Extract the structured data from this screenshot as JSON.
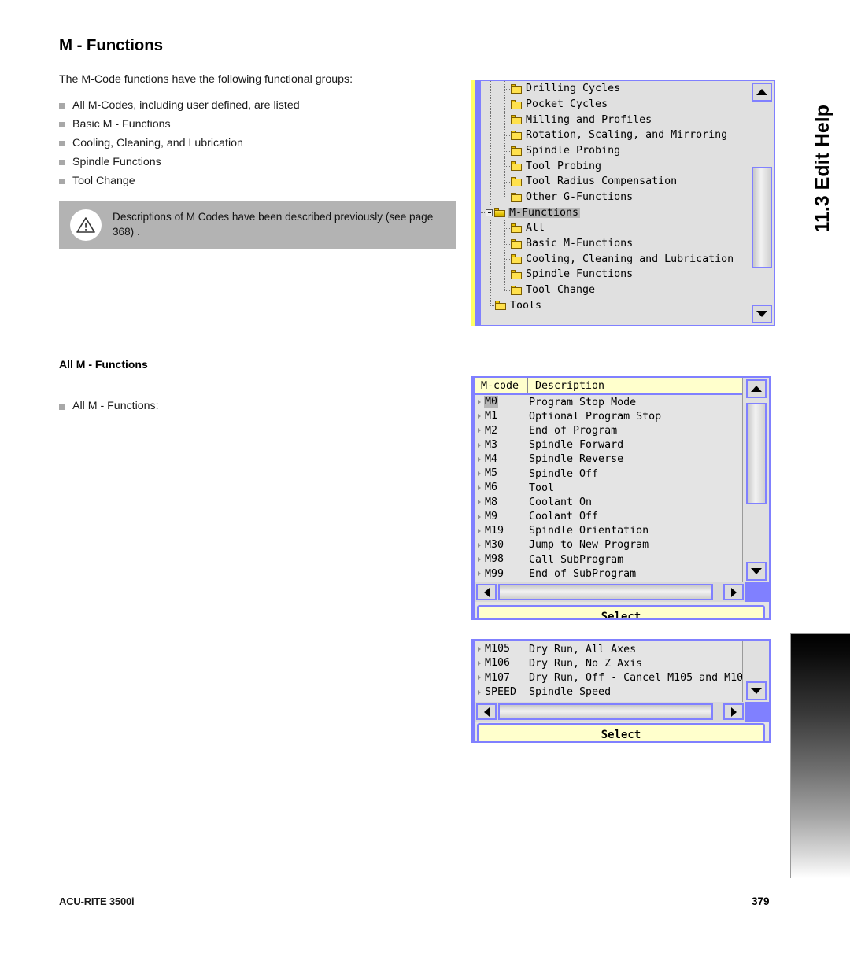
{
  "document": {
    "title": "M - Functions",
    "intro": "The M-Code functions have the following functional groups:",
    "groups": [
      "All M-Codes, including user defined, are listed",
      "Basic M - Functions",
      "Cooling, Cleaning, and Lubrication",
      "Spindle Functions",
      "Tool Change"
    ],
    "note": {
      "icon": "warning-triangle-icon",
      "text": "Descriptions of M Codes have been described previously (see page 368) ."
    },
    "section_heading": "All M - Functions",
    "section_bullet": "All M - Functions:",
    "chapter_tab": "11.3 Edit Help",
    "footer_left": "ACU-RITE 3500i",
    "footer_right": "379"
  },
  "tree_widget": {
    "name": "help-topic-tree",
    "items": [
      {
        "label": "Drilling Cycles",
        "indent": 1,
        "icon": "folder-icon",
        "selected": false,
        "expander": "none",
        "last": false
      },
      {
        "label": "Pocket Cycles",
        "indent": 1,
        "icon": "folder-icon",
        "selected": false,
        "expander": "none",
        "last": false
      },
      {
        "label": "Milling and Profiles",
        "indent": 1,
        "icon": "folder-icon",
        "selected": false,
        "expander": "none",
        "last": false
      },
      {
        "label": "Rotation, Scaling, and Mirroring",
        "indent": 1,
        "icon": "folder-icon",
        "selected": false,
        "expander": "none",
        "last": false
      },
      {
        "label": "Spindle Probing",
        "indent": 1,
        "icon": "folder-icon",
        "selected": false,
        "expander": "none",
        "last": false
      },
      {
        "label": "Tool Probing",
        "indent": 1,
        "icon": "folder-icon",
        "selected": false,
        "expander": "none",
        "last": false
      },
      {
        "label": "Tool Radius Compensation",
        "indent": 1,
        "icon": "folder-icon",
        "selected": false,
        "expander": "none",
        "last": false
      },
      {
        "label": "Other G-Functions",
        "indent": 1,
        "icon": "folder-icon",
        "selected": false,
        "expander": "none",
        "last": true
      },
      {
        "label": "M-Functions",
        "indent": 0,
        "icon": "folder-open-icon",
        "selected": true,
        "expander": "minus",
        "last": false
      },
      {
        "label": "All",
        "indent": 1,
        "icon": "folder-icon",
        "selected": false,
        "expander": "none",
        "last": false
      },
      {
        "label": "Basic M-Functions",
        "indent": 1,
        "icon": "folder-icon",
        "selected": false,
        "expander": "none",
        "last": false
      },
      {
        "label": "Cooling, Cleaning and Lubrication",
        "indent": 1,
        "icon": "folder-icon",
        "selected": false,
        "expander": "none",
        "last": false
      },
      {
        "label": "Spindle Functions",
        "indent": 1,
        "icon": "folder-icon",
        "selected": false,
        "expander": "none",
        "last": false
      },
      {
        "label": "Tool Change",
        "indent": 1,
        "icon": "folder-icon",
        "selected": false,
        "expander": "none",
        "last": true
      },
      {
        "label": "Tools",
        "indent": 0,
        "icon": "folder-icon",
        "selected": false,
        "expander": "none",
        "last": true
      }
    ],
    "scrollbar": {
      "up_icon": "scroll-up-arrow-icon",
      "down_icon": "scroll-down-arrow-icon",
      "thumb_top_pct": 32,
      "thumb_height_pct": 50
    }
  },
  "table_all": {
    "name": "m-code-table-all",
    "columns": [
      "M-code",
      "Description"
    ],
    "rows": [
      {
        "code": "M0",
        "desc": "Program Stop Mode",
        "selected": true
      },
      {
        "code": "M1",
        "desc": "Optional Program Stop",
        "selected": false
      },
      {
        "code": "M2",
        "desc": "End of Program",
        "selected": false
      },
      {
        "code": "M3",
        "desc": "Spindle Forward",
        "selected": false
      },
      {
        "code": "M4",
        "desc": "Spindle Reverse",
        "selected": false
      },
      {
        "code": "M5",
        "desc": "Spindle Off",
        "selected": false
      },
      {
        "code": "M6",
        "desc": "Tool",
        "selected": false
      },
      {
        "code": "M8",
        "desc": "Coolant On",
        "selected": false
      },
      {
        "code": "M9",
        "desc": "Coolant Off",
        "selected": false
      },
      {
        "code": "M19",
        "desc": "Spindle Orientation",
        "selected": false
      },
      {
        "code": "M30",
        "desc": "Jump to New Program",
        "selected": false
      },
      {
        "code": "M98",
        "desc": "Call SubProgram",
        "selected": false
      },
      {
        "code": "M99",
        "desc": "End of SubProgram",
        "selected": false
      }
    ],
    "select_label": "Select",
    "vscroll": {
      "thumb_top_pct": 3,
      "thumb_height_pct": 62
    },
    "hscroll": {
      "thumb_left_pct": 0,
      "thumb_width_pct": 96
    }
  },
  "table_more": {
    "name": "m-code-table-continued",
    "rows": [
      {
        "code": "M105",
        "desc": "Dry Run, All Axes",
        "selected": false
      },
      {
        "code": "M106",
        "desc": "Dry Run, No Z Axis",
        "selected": false
      },
      {
        "code": "M107",
        "desc": "Dry Run, Off - Cancel M105 and M10",
        "selected": false
      },
      {
        "code": "SPEED",
        "desc": "Spindle Speed",
        "selected": false
      }
    ],
    "select_label": "Select",
    "hscroll": {
      "thumb_left_pct": 0,
      "thumb_width_pct": 96
    }
  },
  "colors": {
    "accent_blue": "#8080ff",
    "header_yellow": "#ffffcc",
    "folder_yellow": "#ffe14d",
    "selection_gray": "#b5b5b5",
    "note_bg": "#b3b3b3"
  }
}
